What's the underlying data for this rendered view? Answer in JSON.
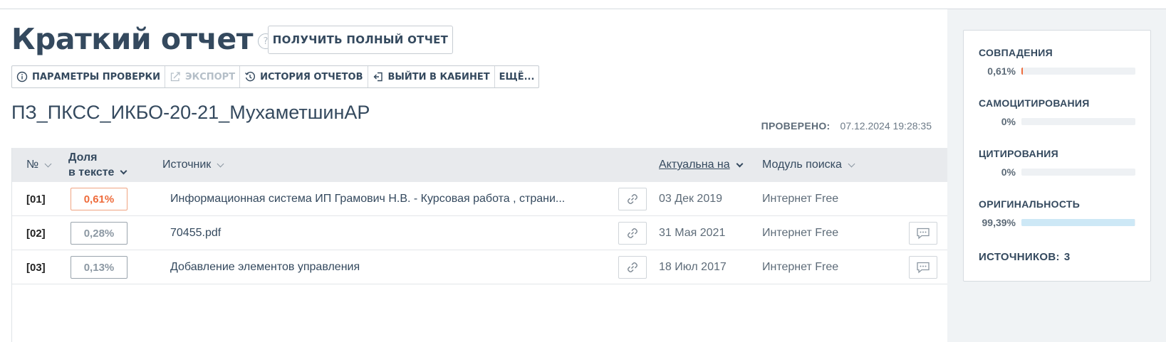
{
  "header": {
    "title": "Краткий отчет",
    "help": "?",
    "full_report_label": "ПОЛУЧИТЬ ПОЛНЫЙ ОТЧЕТ"
  },
  "toolbar": {
    "params_label": "ПАРАМЕТРЫ ПРОВЕРКИ",
    "export_label": "ЭКСПОРТ",
    "history_label": "ИСТОРИЯ ОТЧЕТОВ",
    "exit_label": "ВЫЙТИ В КАБИНЕТ",
    "more_label": "ЕЩЁ..."
  },
  "document": {
    "title": "ПЗ_ПКСС_ИКБО-20-21_МухаметшинАР",
    "checked_label": "ПРОВЕРЕНО:",
    "checked_value": "07.12.2024 19:28:35"
  },
  "table": {
    "col_num": "№",
    "col_share_line1": "Доля",
    "col_share_line2": "в тексте",
    "col_source": "Источник",
    "col_actual": "Актуальна на",
    "col_module": "Модуль поиска",
    "rows": [
      {
        "num": "[01]",
        "pct": "0,61%",
        "source": "Информационная система ИП Грамович Н.В. - Курсовая работа , страни...",
        "date": "03 Дек 2019",
        "module": "Интернет Free"
      },
      {
        "num": "[02]",
        "pct": "0,28%",
        "source": "70455.pdf",
        "date": "31 Мая 2021",
        "module": "Интернет Free"
      },
      {
        "num": "[03]",
        "pct": "0,13%",
        "source": "Добавление элементов управления",
        "date": "18 Июл 2017",
        "module": "Интернет Free"
      }
    ]
  },
  "stats": {
    "matches_label": "СОВПАДЕНИЯ",
    "matches_value": "0,61%",
    "matches_fraction": 0.0061,
    "selfcite_label": "САМОЦИТИРОВАНИЯ",
    "selfcite_value": "0%",
    "selfcite_fraction": 0,
    "citation_label": "ЦИТИРОВАНИЯ",
    "citation_value": "0%",
    "citation_fraction": 0,
    "original_label": "ОРИГИНАЛЬНОСТЬ",
    "original_value": "99,39%",
    "original_fraction": 0.9939,
    "sources_label": "ИСТОЧНИКОВ:",
    "sources_count": "3"
  },
  "colors": {
    "matches_bar": "#ee6b3b",
    "original_bar": "#cde8f6",
    "title": "#34495e"
  }
}
